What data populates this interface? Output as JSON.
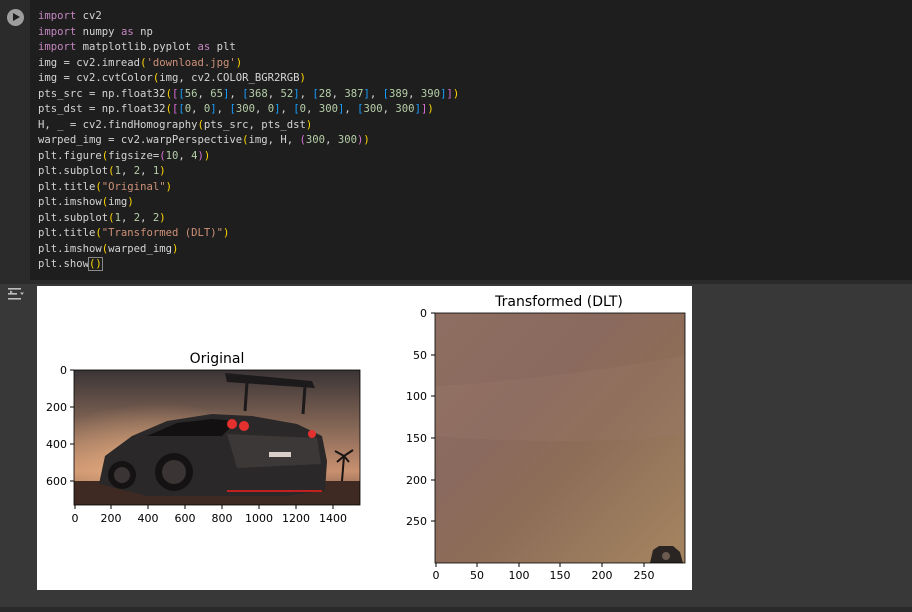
{
  "cell": {
    "run_button_label": "Run cell",
    "code_lines": [
      "import cv2",
      "import numpy as np",
      "import matplotlib.pyplot as plt",
      "img = cv2.imread('download.jpg')",
      "img = cv2.cvtColor(img, cv2.COLOR_BGR2RGB)",
      "pts_src = np.float32([[56, 65], [368, 52], [28, 387], [389, 390]])",
      "pts_dst = np.float32([[0, 0], [300, 0], [0, 300], [300, 300]])",
      "H, _ = cv2.findHomography(pts_src, pts_dst)",
      "warped_img = cv2.warpPerspective(img, H, (300, 300))",
      "plt.figure(figsize=(10, 4))",
      "plt.subplot(1, 2, 1)",
      "plt.title(\"Original\")",
      "plt.imshow(img)",
      "plt.subplot(1, 2, 2)",
      "plt.title(\"Transformed (DLT)\")",
      "plt.imshow(warped_img)",
      "plt.show()"
    ]
  },
  "output": {
    "icon": "output-toggle-icon",
    "plots": [
      {
        "title": "Original",
        "xticks": [
          "0",
          "200",
          "400",
          "600",
          "800",
          "1000",
          "1200",
          "1400"
        ],
        "yticks": [
          "0",
          "200",
          "400",
          "600"
        ],
        "image": "sports car rear view at sunset"
      },
      {
        "title": "Transformed (DLT)",
        "xticks": [
          "0",
          "50",
          "100",
          "150",
          "200",
          "250"
        ],
        "yticks": [
          "0",
          "50",
          "100",
          "150",
          "200",
          "250"
        ],
        "image": "warped brown gradient region"
      }
    ]
  },
  "colors": {
    "editor_bg": "#1e1e1e",
    "page_bg": "#383838",
    "keyword": "#c586c0",
    "string": "#ce9178",
    "number": "#b5cea8"
  }
}
